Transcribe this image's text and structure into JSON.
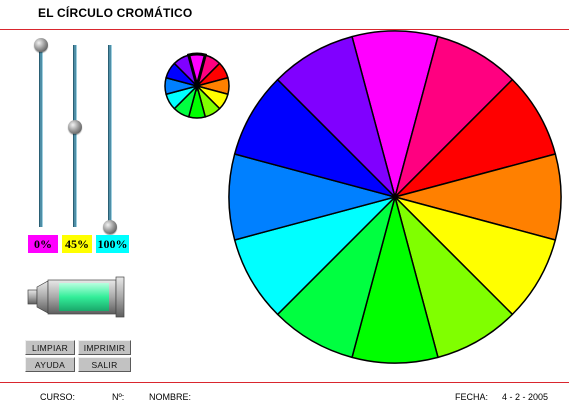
{
  "title": "EL CÍRCULO CROMÁTICO",
  "sliders": [
    {
      "name": "magenta",
      "value": "0%",
      "color": "#ff00ff",
      "level": 0
    },
    {
      "name": "yellow",
      "value": "45%",
      "color": "#ffff00",
      "level": 0.45
    },
    {
      "name": "cyan",
      "value": "100%",
      "color": "#00ffff",
      "level": 1
    }
  ],
  "mixed_color": "#33ee99",
  "buttons": {
    "limpiar": "LIMPIAR",
    "imprimir": "IMPRIMIR",
    "ayuda": "AYUDA",
    "salir": "SALIR"
  },
  "footer": {
    "curso_label": "CURSO:",
    "no_label": "Nº:",
    "nombre_label": "NOMBRE:",
    "fecha_label": "FECHA:",
    "fecha_value": "4 - 2 - 2005"
  },
  "wheel": {
    "segments": [
      "#ff00ff",
      "#ff0080",
      "#ff0000",
      "#ff8000",
      "#ffff00",
      "#80ff00",
      "#00ff00",
      "#00ff40",
      "#00ffff",
      "#0080ff",
      "#0000ff",
      "#8000ff"
    ],
    "selected_index": 0
  }
}
